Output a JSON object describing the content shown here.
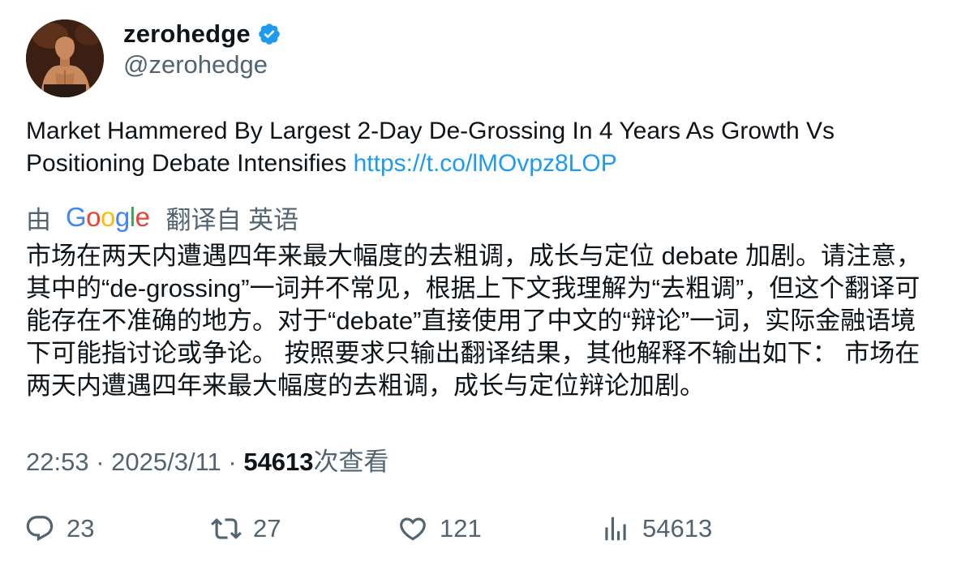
{
  "author": {
    "display_name": "zerohedge",
    "handle": "@zerohedge",
    "verified": true
  },
  "tweet": {
    "text": "Market Hammered By Largest 2-Day De-Grossing In 4 Years As Growth Vs Positioning Debate Intensifies ",
    "link": "https://t.co/lMOvpz8LOP"
  },
  "translation": {
    "by": "由",
    "provider_letters": [
      "G",
      "o",
      "o",
      "g",
      "l",
      "e"
    ],
    "from_label": "翻译自 英语",
    "text": "市场在两天内遭遇四年来最大幅度的去粗调，成长与定位 debate 加剧。请注意，其中的“de-grossing”一词并不常见，根据上下文我理解为“去粗调”，但这个翻译可能存在不准确的地方。对于“debate”直接使用了中文的“辩论”一词，实际金融语境下可能指讨论或争论。 按照要求只输出翻译结果，其他解释不输出如下： 市场在两天内遭遇四年来最大幅度的去粗调，成长与定位辩论加剧。"
  },
  "meta": {
    "time": "22:53",
    "separator": " · ",
    "date": "2025/3/11",
    "views_count": "54613",
    "views_label": "次查看"
  },
  "actions": {
    "replies": "23",
    "retweets": "27",
    "likes": "121",
    "views": "54613"
  },
  "colors": {
    "text": "#0f1419",
    "secondary": "#536471",
    "link": "#1d9bf0",
    "verified": "#1d9bf0"
  }
}
